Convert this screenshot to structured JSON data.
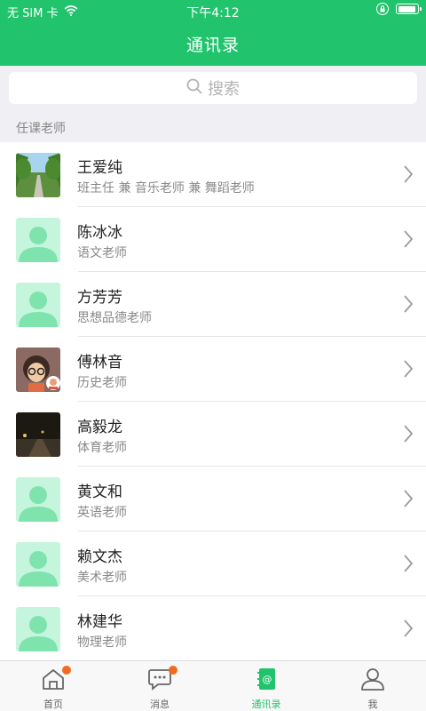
{
  "status": {
    "carrier": "无 SIM 卡",
    "time": "下午4:12",
    "battery_level": 0.95
  },
  "header": {
    "title": "通讯录"
  },
  "search": {
    "placeholder": "搜索"
  },
  "section": {
    "label": "任课老师"
  },
  "contacts": [
    {
      "name": "王爱纯",
      "role": "班主任 兼 音乐老师 兼 舞蹈老师",
      "avatar": "photo-trees"
    },
    {
      "name": "陈冰冰",
      "role": "语文老师",
      "avatar": "default-avatar"
    },
    {
      "name": "方芳芳",
      "role": "思想品德老师",
      "avatar": "default-avatar"
    },
    {
      "name": "傅林音",
      "role": "历史老师",
      "avatar": "photo-cartoon"
    },
    {
      "name": "高毅龙",
      "role": "体育老师",
      "avatar": "photo-night-street"
    },
    {
      "name": "黄文和",
      "role": "英语老师",
      "avatar": "default-avatar"
    },
    {
      "name": "赖文杰",
      "role": "美术老师",
      "avatar": "default-avatar"
    },
    {
      "name": "林建华",
      "role": "物理老师",
      "avatar": "default-avatar"
    }
  ],
  "tabbar": {
    "tabs": [
      {
        "label": "首页",
        "icon": "home-icon",
        "badge": true,
        "active": false
      },
      {
        "label": "消息",
        "icon": "chat-icon",
        "badge": true,
        "active": false
      },
      {
        "label": "通讯录",
        "icon": "contacts-book-icon",
        "badge": false,
        "active": true
      },
      {
        "label": "我",
        "icon": "person-icon",
        "badge": false,
        "active": false
      }
    ]
  },
  "colors": {
    "brand": "#21c46c",
    "badge": "#f16a1f",
    "avatar_bg": "#c6f5dd",
    "avatar_fg": "#7fe3ae"
  }
}
